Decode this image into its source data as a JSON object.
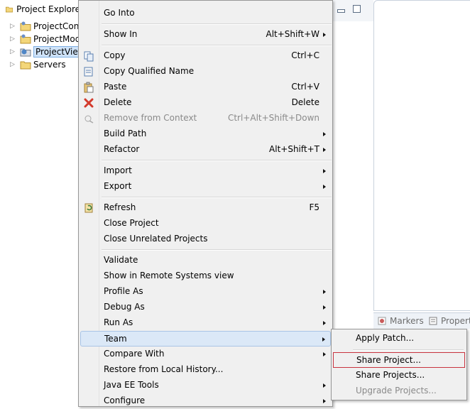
{
  "explorer": {
    "title": "Project Explorer",
    "items": [
      {
        "label": "ProjectConf",
        "selected": false
      },
      {
        "label": "ProjectMod",
        "selected": false
      },
      {
        "label": "ProjectView",
        "selected": true
      },
      {
        "label": "Servers",
        "selected": false
      }
    ]
  },
  "bottom_tabs": {
    "markers": "Markers",
    "properties": "Propert"
  },
  "context_menu": {
    "go_into": {
      "label": "Go Into"
    },
    "show_in": {
      "label": "Show In",
      "shortcut": "Alt+Shift+W"
    },
    "copy": {
      "label": "Copy",
      "shortcut": "Ctrl+C"
    },
    "copy_qualified": {
      "label": "Copy Qualified Name"
    },
    "paste": {
      "label": "Paste",
      "shortcut": "Ctrl+V"
    },
    "delete": {
      "label": "Delete",
      "shortcut": "Delete"
    },
    "remove_context": {
      "label": "Remove from Context",
      "shortcut": "Ctrl+Alt+Shift+Down"
    },
    "build_path": {
      "label": "Build Path"
    },
    "refactor": {
      "label": "Refactor",
      "shortcut": "Alt+Shift+T"
    },
    "import": {
      "label": "Import"
    },
    "export": {
      "label": "Export"
    },
    "refresh": {
      "label": "Refresh",
      "shortcut": "F5"
    },
    "close_project": {
      "label": "Close Project"
    },
    "close_unrelated": {
      "label": "Close Unrelated Projects"
    },
    "validate": {
      "label": "Validate"
    },
    "show_remote": {
      "label": "Show in Remote Systems view"
    },
    "profile_as": {
      "label": "Profile As"
    },
    "debug_as": {
      "label": "Debug As"
    },
    "run_as": {
      "label": "Run As"
    },
    "team": {
      "label": "Team"
    },
    "compare_with": {
      "label": "Compare With"
    },
    "restore_history": {
      "label": "Restore from Local History..."
    },
    "java_ee_tools": {
      "label": "Java EE Tools"
    },
    "configure": {
      "label": "Configure"
    }
  },
  "team_submenu": {
    "apply_patch": {
      "label": "Apply Patch..."
    },
    "share_project": {
      "label": "Share Project..."
    },
    "share_projects": {
      "label": "Share Projects..."
    },
    "upgrade_projects": {
      "label": "Upgrade Projects..."
    }
  },
  "colors": {
    "menu_bg": "#f0f0f0",
    "highlight": "#dbe8f7",
    "focus_border": "#c8333f",
    "disabled_text": "#8a8a8a"
  }
}
